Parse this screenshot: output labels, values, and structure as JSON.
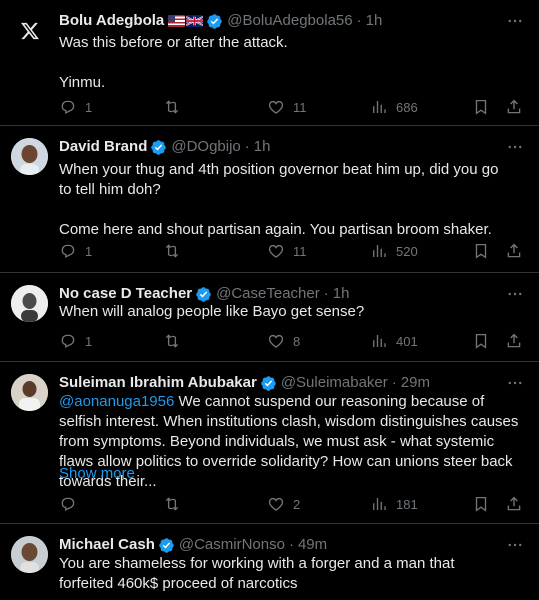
{
  "tweets": [
    {
      "name": "Bolu Adegbola",
      "handle": "@BoluAdegbola56",
      "separator": "·",
      "time": "1h",
      "avatar_icon": "x-logo-icon",
      "flags": [
        "us-flag-icon",
        "uk-flag-icon"
      ],
      "text": [
        "Was this before or after the attack.",
        "",
        "Yinmu."
      ],
      "replies": "1",
      "retweets": "",
      "likes": "11",
      "views": "686"
    },
    {
      "name": "David Brand",
      "handle": "@DOgbijo",
      "separator": "·",
      "time": "1h",
      "text": [
        "When your thug and 4th position governor beat him up, did you go to tell him doh?",
        "",
        "Come here and shout partisan again. You partisan broom shaker."
      ],
      "replies": "1",
      "retweets": "",
      "likes": "11",
      "views": "520"
    },
    {
      "name": "No case D Teacher",
      "handle": "@CaseTeacher",
      "separator": "·",
      "time": "1h",
      "text": [
        "When will analog people like Bayo get sense?"
      ],
      "replies": "1",
      "retweets": "",
      "likes": "8",
      "views": "401"
    },
    {
      "name": "Suleiman Ibrahim Abubakar",
      "handle": "@Suleimabaker",
      "separator": "·",
      "time": "29m",
      "mention": "@aonanuga1956",
      "text_after_mention": " We cannot suspend our reasoning because of selfish interest. When institutions clash, wisdom distinguishes causes from symptoms. Beyond individuals, we must ask - what systemic flaws allow politics to override solidarity? How can unions steer back towards their...",
      "show_more": "Show more",
      "replies": "",
      "retweets": "",
      "likes": "2",
      "views": "181"
    },
    {
      "name": "Michael Cash",
      "handle": "@CasmirNonso",
      "separator": "·",
      "time": "49m",
      "text": [
        "You are shameless for working with a forger and a man that forfeited 460k$ proceed of narcotics"
      ]
    }
  ],
  "colors": {
    "background": "#000000",
    "text": "#e7e9ea",
    "muted": "#71767b",
    "accent": "#1d9bf0",
    "divider": "#2f3336"
  }
}
